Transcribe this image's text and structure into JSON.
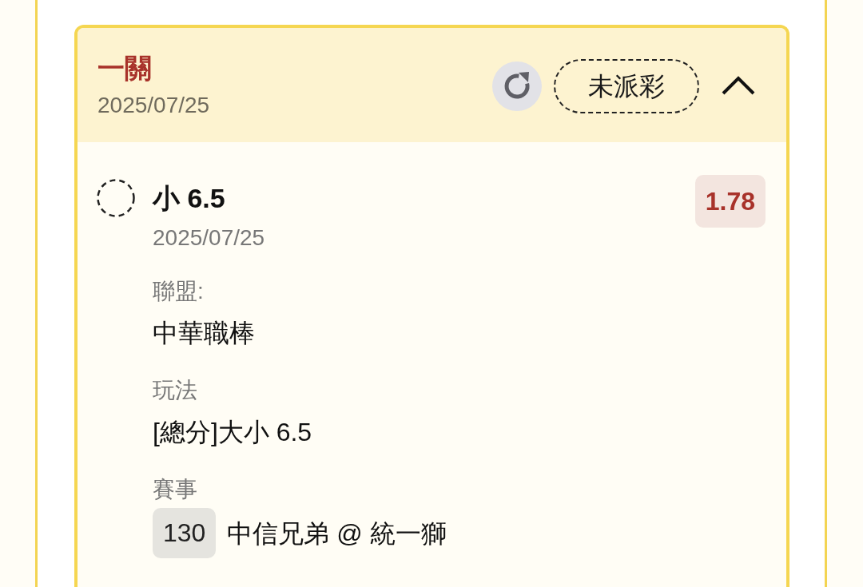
{
  "card": {
    "title": "一關",
    "date": "2025/07/25",
    "status": "未派彩",
    "expanded": true
  },
  "bet": {
    "pick": "小 6.5",
    "date": "2025/07/25",
    "odds": "1.78",
    "fields": [
      {
        "kind": "text",
        "label": "聯盟:",
        "value": "中華職棒"
      },
      {
        "kind": "text",
        "label": "玩法",
        "value": "[總分]大小 6.5"
      },
      {
        "kind": "game",
        "label": "賽事",
        "number": "130",
        "value": "中信兄弟 @ 統一獅"
      }
    ]
  }
}
